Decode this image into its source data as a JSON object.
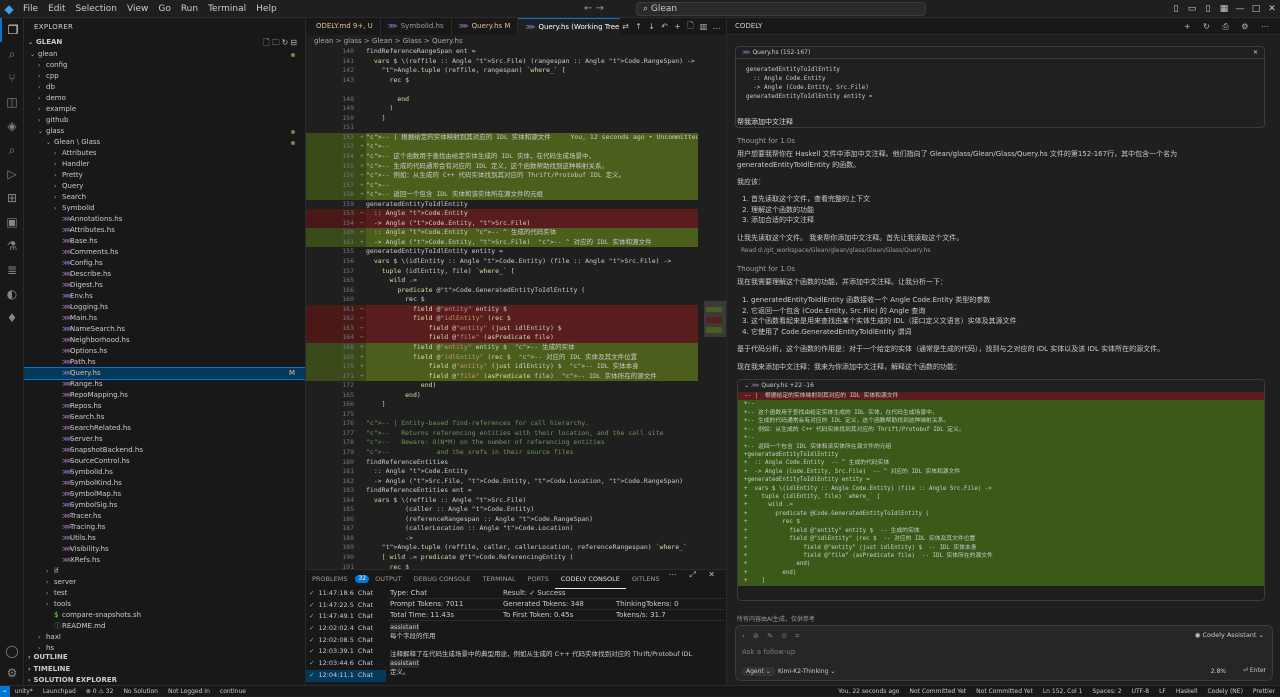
{
  "titlebar": {
    "menu": [
      "File",
      "Edit",
      "Selection",
      "View",
      "Go",
      "Run",
      "Terminal",
      "Help"
    ],
    "search": "Glean"
  },
  "sidebar": {
    "header": "EXPLORER",
    "root": "GLEAN",
    "items": [
      {
        "label": "glean",
        "depth": 0,
        "type": "folder",
        "open": true,
        "dot": true
      },
      {
        "label": "config",
        "depth": 1,
        "type": "folder"
      },
      {
        "label": "cpp",
        "depth": 1,
        "type": "folder"
      },
      {
        "label": "db",
        "depth": 1,
        "type": "folder"
      },
      {
        "label": "demo",
        "depth": 1,
        "type": "folder"
      },
      {
        "label": "example",
        "depth": 1,
        "type": "folder"
      },
      {
        "label": "github",
        "depth": 1,
        "type": "folder"
      },
      {
        "label": "glass",
        "depth": 1,
        "type": "folder",
        "open": true,
        "dot": true
      },
      {
        "label": "Glean \\ Glass",
        "depth": 2,
        "type": "folder",
        "open": true,
        "dot": true
      },
      {
        "label": "Attributes",
        "depth": 3,
        "type": "folder"
      },
      {
        "label": "Handler",
        "depth": 3,
        "type": "folder"
      },
      {
        "label": "Pretty",
        "depth": 3,
        "type": "folder"
      },
      {
        "label": "Query",
        "depth": 3,
        "type": "folder"
      },
      {
        "label": "Search",
        "depth": 3,
        "type": "folder"
      },
      {
        "label": "SymbolId",
        "depth": 3,
        "type": "folder"
      },
      {
        "label": "Annotations.hs",
        "depth": 3,
        "type": "file"
      },
      {
        "label": "Attributes.hs",
        "depth": 3,
        "type": "file"
      },
      {
        "label": "Base.hs",
        "depth": 3,
        "type": "file"
      },
      {
        "label": "Comments.hs",
        "depth": 3,
        "type": "file"
      },
      {
        "label": "Config.hs",
        "depth": 3,
        "type": "file"
      },
      {
        "label": "Describe.hs",
        "depth": 3,
        "type": "file"
      },
      {
        "label": "Digest.hs",
        "depth": 3,
        "type": "file"
      },
      {
        "label": "Env.hs",
        "depth": 3,
        "type": "file"
      },
      {
        "label": "Logging.hs",
        "depth": 3,
        "type": "file"
      },
      {
        "label": "Main.hs",
        "depth": 3,
        "type": "file"
      },
      {
        "label": "NameSearch.hs",
        "depth": 3,
        "type": "file"
      },
      {
        "label": "Neighborhood.hs",
        "depth": 3,
        "type": "file"
      },
      {
        "label": "Options.hs",
        "depth": 3,
        "type": "file"
      },
      {
        "label": "Path.hs",
        "depth": 3,
        "type": "file"
      },
      {
        "label": "Query.hs",
        "depth": 3,
        "type": "file",
        "selected": true,
        "badge": "M"
      },
      {
        "label": "Range.hs",
        "depth": 3,
        "type": "file"
      },
      {
        "label": "RepoMapping.hs",
        "depth": 3,
        "type": "file"
      },
      {
        "label": "Repos.hs",
        "depth": 3,
        "type": "file"
      },
      {
        "label": "Search.hs",
        "depth": 3,
        "type": "file"
      },
      {
        "label": "SearchRelated.hs",
        "depth": 3,
        "type": "file"
      },
      {
        "label": "Server.hs",
        "depth": 3,
        "type": "file"
      },
      {
        "label": "SnapshotBackend.hs",
        "depth": 3,
        "type": "file"
      },
      {
        "label": "SourceControl.hs",
        "depth": 3,
        "type": "file"
      },
      {
        "label": "SymbolId.hs",
        "depth": 3,
        "type": "file"
      },
      {
        "label": "SymbolKind.hs",
        "depth": 3,
        "type": "file"
      },
      {
        "label": "SymbolMap.hs",
        "depth": 3,
        "type": "file"
      },
      {
        "label": "SymbolSig.hs",
        "depth": 3,
        "type": "file"
      },
      {
        "label": "Tracer.hs",
        "depth": 3,
        "type": "file"
      },
      {
        "label": "Tracing.hs",
        "depth": 3,
        "type": "file"
      },
      {
        "label": "Utils.hs",
        "depth": 3,
        "type": "file"
      },
      {
        "label": "Visibility.hs",
        "depth": 3,
        "type": "file"
      },
      {
        "label": "XRefs.hs",
        "depth": 3,
        "type": "file"
      },
      {
        "label": "if",
        "depth": 2,
        "type": "folder"
      },
      {
        "label": "server",
        "depth": 2,
        "type": "folder"
      },
      {
        "label": "test",
        "depth": 2,
        "type": "folder"
      },
      {
        "label": "tools",
        "depth": 2,
        "type": "folder"
      },
      {
        "label": "compare-snapshots.sh",
        "depth": 2,
        "type": "file"
      },
      {
        "label": "README.md",
        "depth": 2,
        "type": "file"
      },
      {
        "label": "haxl",
        "depth": 1,
        "type": "folder"
      },
      {
        "label": "hs",
        "depth": 1,
        "type": "folder"
      }
    ],
    "outline": "OUTLINE",
    "timeline": "TIMELINE",
    "solution": "SOLUTION EXPLORER"
  },
  "editor": {
    "tabs": [
      {
        "label": "ODELY.md 9+, U",
        "mod": true
      },
      {
        "label": "SymbolId.hs"
      },
      {
        "label": "Query.hs M",
        "mod": true
      },
      {
        "label": "Query.hs (Working Tree) M",
        "active": true
      }
    ],
    "breadcrumb": "glean > glass > Glean > Glass > Query.hs",
    "lines": [
      {
        "n": "140",
        "k": "n",
        "t": "findReferenceRangeSpan ent ="
      },
      {
        "n": "141",
        "k": "n",
        "t": "  vars $ \\(reffile :: Angle Src.File) (rangespan :: Angle Code.RangeSpan) ->"
      },
      {
        "n": "142",
        "k": "n",
        "t": "    Angle.tuple (reffile, rangespan) `where_` ["
      },
      {
        "n": "143",
        "k": "n",
        "t": "      rec $"
      },
      {
        "n": "",
        "k": "n",
        "t": ""
      },
      {
        "n": "148",
        "k": "n",
        "t": "        end"
      },
      {
        "n": "149",
        "k": "n",
        "t": "      )"
      },
      {
        "n": "150",
        "k": "n",
        "t": "    ]"
      },
      {
        "n": "151",
        "k": "n",
        "t": ""
      },
      {
        "n": "152",
        "k": "a",
        "t": "-- | 根据给定的实体映射到其对应的 IDL 实体和源文件     You, 12 seconds ago • Uncommitted change"
      },
      {
        "n": "153",
        "k": "a",
        "t": "--"
      },
      {
        "n": "154",
        "k": "a",
        "t": "-- 这个函数用于查找由给定实体生成的 IDL 实体，在代码生成场景中，"
      },
      {
        "n": "155",
        "k": "a",
        "t": "-- 生成的代码通常会有对应的 IDL 定义，这个函数帮助找到这种映射关系。"
      },
      {
        "n": "156",
        "k": "a",
        "t": "-- 例如：从生成的 C++ 代码实体找到其对应的 Thrift/Protobuf IDL 定义。"
      },
      {
        "n": "157",
        "k": "a",
        "t": "--"
      },
      {
        "n": "158",
        "k": "a",
        "t": "-- 返回一个包含 IDL 实体和该实体所在源文件的元组"
      },
      {
        "n": "159",
        "k": "n",
        "t": "generatedEntityToIdlEntity"
      },
      {
        "n": "153",
        "k": "d",
        "t": "  :: Angle Code.Entity"
      },
      {
        "n": "154",
        "k": "d",
        "t": "  -> Angle (Code.Entity, Src.File)"
      },
      {
        "n": "160",
        "k": "a",
        "t": "  :: Angle Code.Entity  -- ^ 生成的代码实体"
      },
      {
        "n": "161",
        "k": "a",
        "t": "  -> Angle (Code.Entity, Src.File)  -- ^ 对应的 IDL 实体和源文件"
      },
      {
        "n": "155",
        "k": "n",
        "t": "generatedEntityToIdlEntity entity ="
      },
      {
        "n": "156",
        "k": "n",
        "t": "  vars $ \\(idlEntity :: Angle Code.Entity) (file :: Angle Src.File) ->"
      },
      {
        "n": "157",
        "k": "n",
        "t": "    tuple (idlEntity, file) `where_` ["
      },
      {
        "n": "165",
        "k": "n",
        "t": "      wild .="
      },
      {
        "n": "166",
        "k": "n",
        "t": "        predicate @Code.GeneratedEntityToIdlEntity ("
      },
      {
        "n": "160",
        "k": "n",
        "t": "          rec $"
      },
      {
        "n": "161",
        "k": "d",
        "t": "            field @\"entity\" entity $"
      },
      {
        "n": "162",
        "k": "d",
        "t": "            field @\"idlEntity\" (rec $"
      },
      {
        "n": "163",
        "k": "d",
        "t": "                field @\"entity\" (just idlEntity) $"
      },
      {
        "n": "164",
        "k": "d",
        "t": "                field @\"file\" (asPredicate file)"
      },
      {
        "n": "168",
        "k": "a",
        "t": "            field @\"entity\" entity $  -- 生成的实体"
      },
      {
        "n": "169",
        "k": "a",
        "t": "            field @\"idlEntity\" (rec $  -- 对应的 IDL 实体及其文件位置"
      },
      {
        "n": "170",
        "k": "a",
        "t": "                field @\"entity\" (just idlEntity) $  -- IDL 实体本身"
      },
      {
        "n": "171",
        "k": "a",
        "t": "                field @\"file\" (asPredicate file)  -- IDL 实体所在的源文件"
      },
      {
        "n": "172",
        "k": "n",
        "t": "              end)"
      },
      {
        "n": "165",
        "k": "n",
        "t": "          end)"
      },
      {
        "n": "166",
        "k": "n",
        "t": "    ]"
      },
      {
        "n": "175",
        "k": "n",
        "t": ""
      },
      {
        "n": "176",
        "k": "c",
        "t": "-- | Entity-based find-references for call hierarchy."
      },
      {
        "n": "177",
        "k": "c",
        "t": "--   Returns referencing entities with their location, and the call site"
      },
      {
        "n": "178",
        "k": "c",
        "t": "--   Beware: O(N*M) on the number of referencing entities"
      },
      {
        "n": "179",
        "k": "c",
        "t": "--            and the xrefs in their source files"
      },
      {
        "n": "180",
        "k": "n",
        "t": "findReferenceEntities"
      },
      {
        "n": "181",
        "k": "n",
        "t": "  :: Angle Code.Entity"
      },
      {
        "n": "182",
        "k": "n",
        "t": "  -> Angle (Src.File, Code.Entity, Code.Location, Code.RangeSpan)"
      },
      {
        "n": "183",
        "k": "n",
        "t": "findReferenceEntities ent ="
      },
      {
        "n": "184",
        "k": "n",
        "t": "  vars $ \\(reffile :: Angle Src.File)"
      },
      {
        "n": "185",
        "k": "n",
        "t": "          (caller :: Angle Code.Entity)"
      },
      {
        "n": "186",
        "k": "n",
        "t": "          (referenceRangespan :: Angle Code.RangeSpan)"
      },
      {
        "n": "187",
        "k": "n",
        "t": "          (callerLocation :: Angle Code.Location)"
      },
      {
        "n": "188",
        "k": "n",
        "t": "          ->"
      },
      {
        "n": "189",
        "k": "n",
        "t": "    Angle.tuple (reffile, caller, callerLocation, referenceRangespan) `where_`"
      },
      {
        "n": "190",
        "k": "n",
        "t": "    [ wild .= predicate @Code.ReferencingEntity ("
      },
      {
        "n": "191",
        "k": "n",
        "t": "      rec $"
      },
      {
        "n": "192",
        "k": "n",
        "t": "        field @\"target\" ent $"
      }
    ]
  },
  "panel": {
    "tabs": [
      "PROBLEMS",
      "OUTPUT",
      "DEBUG CONSOLE",
      "TERMINAL",
      "PORTS",
      "CODELY CONSOLE",
      "GITLENS"
    ],
    "problems_count": "32",
    "entries": [
      {
        "time": "11:47:18.6",
        "type": "Chat"
      },
      {
        "time": "11:47:22.5",
        "type": "Chat"
      },
      {
        "time": "11:47:49.1",
        "type": "Chat"
      },
      {
        "time": "12:02:02.4",
        "type": "Chat"
      },
      {
        "time": "12:02:08.5",
        "type": "Chat"
      },
      {
        "time": "12:03:39.1",
        "type": "Chat"
      },
      {
        "time": "12:03:44.6",
        "type": "Chat"
      },
      {
        "time": "12:04:11.1",
        "type": "Chat"
      }
    ],
    "detail": {
      "type": "Type: Chat",
      "result": "Result: ✓ Success",
      "prompt": "Prompt Tokens: 7011",
      "generated": "Generated Tokens: 348",
      "thinking": "ThinkingTokens: 0",
      "total": "Total Time: 11.43s",
      "first": "To First Token: 0.45s",
      "tps": "Tokens/s: 31.7",
      "t1": "assistant",
      "t2": "每个字段的作用",
      "t3": "注释解释了在代码生成场景中的典型用途，例如从生成的 C++ 代码实体找到对应的 Thrift/Protobuf IDL",
      "t4": "assistant",
      "t5": "定义。"
    }
  },
  "chat": {
    "header": "CODELY",
    "context_file": "Query.hs (152-167)",
    "context_code": "generatedEntityToIdlEntity\n  :: Angle Code.Entity\n  -> Angle (Code.Entity, Src.File)\ngeneratedEntityToIdlEntity entity =",
    "user_msg": "帮我添加中文注释",
    "thought1": "Thought for 1.0s",
    "p1": "用户想要我帮你在 Haskell 文件中添加中文注释。他们指向了 Glean/glass/Glean/Glass/Query.hs 文件的第152-167行，其中包含一个名为 generatedEntityToIdlEntity 的函数。",
    "p2": "我应该：",
    "steps1": [
      "首先读取这个文件，查看完整的上下文",
      "理解这个函数的功能",
      "添加合适的中文注释"
    ],
    "p3": "让我先读取这个文件。 我来帮你添加中文注释。首先让我读取这个文件。",
    "read": "Read d:/git_workspace/Glean/glean/glass/Glean/Glass/Query.hs",
    "thought2": "Thought for 1.0s",
    "p4": "现在我需要理解这个函数的功能，并添加中文注释。让我分析一下：",
    "steps2": [
      "generatedEntityToIdlEntity 函数接收一个 Angle Code.Entity 类型的参数",
      "它返回一个包含 (Code.Entity, Src.File) 的 Angle 查询",
      "这个函数看起来是用来查找由某个实体生成的 IDL（接口定义文语言）实体及其源文件",
      "它使用了 Code.GeneratedEntityToIdlEntity 谓词"
    ],
    "p5": "基于代码分析，这个函数的作用是：对于一个给定的实体（通常是生成的代码），找到与之对应的 IDL 实体以及该 IDL 实体所在的源文件。",
    "p6": "现在我来添加中文注释：我来为你添加中文注释，解释这个函数的功能：",
    "diff_file": "Query.hs +22 -16",
    "diff": [
      {
        "k": "r",
        "t": "-- |  根据给定的实体映射到其对应的 IDL 实体和源文件"
      },
      {
        "k": "a",
        "t": "+--"
      },
      {
        "k": "a",
        "t": "+-- 这个函数用于查找由给定实体生成的 IDL 实体，在代码生成场景中，"
      },
      {
        "k": "a",
        "t": "+-- 生成的代码通常会有对应的 IDL 定义，这个函数帮助找到这种映射关系。"
      },
      {
        "k": "a",
        "t": "+-- 例如：从生成的 C++ 代码实体找到其对应的 Thrift/Protobuf IDL 定义。"
      },
      {
        "k": "a",
        "t": "+--"
      },
      {
        "k": "a",
        "t": "+-- 返回一个包含 IDL 实体和该实体所在源文件的元组"
      },
      {
        "k": "a",
        "t": "+generatedEntityToIdlEntity"
      },
      {
        "k": "a",
        "t": "+  :: Angle Code.Entity  -- ^ 生成的代码实体"
      },
      {
        "k": "a",
        "t": "+  -> Angle (Code.Entity, Src.File)  -- ^ 对应的 IDL 实体和源文件"
      },
      {
        "k": "a",
        "t": "+generatedEntityToIdlEntity entity ="
      },
      {
        "k": "a",
        "t": "+  vars $ \\(idlEntity :: Angle Code.Entity) (file :: Angle Src.File) ->"
      },
      {
        "k": "a",
        "t": "+    tuple (idlEntity, file) `where_` ["
      },
      {
        "k": "a",
        "t": "+      wild .="
      },
      {
        "k": "a",
        "t": "+        predicate @Code.GeneratedEntityToIdlEntity ("
      },
      {
        "k": "a",
        "t": "+          rec $"
      },
      {
        "k": "a",
        "t": "+            field @\"entity\" entity $  -- 生成的实体"
      },
      {
        "k": "a",
        "t": "+            field @\"idlEntity\" (rec $  -- 对应的 IDL 实体及其文件位置"
      },
      {
        "k": "a",
        "t": "+                field @\"entity\" (just idlEntity) $  -- IDL 实体本身"
      },
      {
        "k": "a",
        "t": "+                field @\"file\" (asPredicate file)  -- IDL 实体所在的源文件"
      },
      {
        "k": "a",
        "t": "+              end)"
      },
      {
        "k": "a",
        "t": "+          end)"
      },
      {
        "k": "a",
        "t": "+    ]"
      }
    ],
    "footnote": "所有内容由AI生成，仅供参考",
    "assistant_select": "Codely Assistant",
    "input_placeholder": "Ask a follow-up",
    "agent": "Agent",
    "model": "Kimi-K2-Thinking",
    "percent": "2.8%",
    "send": "Enter"
  },
  "statusbar": {
    "left": [
      "unity*",
      "Launchpad",
      "⊗ 0 ⚠ 32",
      "No Solution",
      "Not Logged In",
      "continue"
    ],
    "right": [
      "You, 22 seconds ago",
      "Not Committed Yet",
      "Not Committed Yet",
      "Ln 152, Col 1",
      "Spaces: 2",
      "UTF-8",
      "LF",
      "Haskell",
      "Codely (NE)",
      "Prettier"
    ]
  },
  "colors": {
    "accent": "#0078d4",
    "added": "#3b4a19",
    "removed": "#4b1818"
  }
}
